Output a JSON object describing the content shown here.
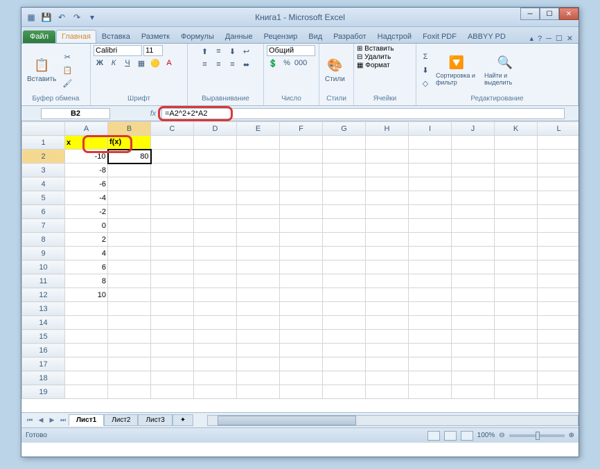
{
  "title": "Книга1 - Microsoft Excel",
  "qat": {
    "save": "💾",
    "undo": "↶",
    "redo": "↷"
  },
  "winbtns": {
    "min": "─",
    "max": "☐",
    "close": "✕"
  },
  "tabs": {
    "file": "Файл",
    "items": [
      "Главная",
      "Вставка",
      "Разметк",
      "Формулы",
      "Данные",
      "Рецензир",
      "Вид",
      "Разработ",
      "Надстрой",
      "Foxit PDF",
      "ABBYY PD"
    ],
    "active_index": 0
  },
  "ribbon": {
    "clipboard": {
      "paste": "Вставить",
      "label": "Буфер обмена",
      "cut": "✂",
      "copy": "📋",
      "brush": "🖌"
    },
    "font": {
      "name": "Calibri",
      "size": "11",
      "label": "Шрифт",
      "bold": "Ж",
      "italic": "К",
      "underline": "Ч"
    },
    "align": {
      "label": "Выравнивание"
    },
    "number": {
      "format": "Общий",
      "label": "Число"
    },
    "styles": {
      "label": "Стили",
      "btn": "Стили"
    },
    "cells": {
      "insert": "Вставить",
      "delete": "Удалить",
      "format": "Формат",
      "label": "Ячейки"
    },
    "editing": {
      "sort": "Сортировка и фильтр",
      "find": "Найти и выделить",
      "label": "Редактирование"
    }
  },
  "namebox": "B2",
  "fx": "fx",
  "formula": "=A2^2+2*A2",
  "columns": [
    "A",
    "B",
    "C",
    "D",
    "E",
    "F",
    "G",
    "H",
    "I",
    "J",
    "K",
    "L"
  ],
  "headers": {
    "a": "x",
    "b": "f(x)"
  },
  "rows": [
    {
      "n": 1
    },
    {
      "n": 2,
      "a": "-10",
      "b": "80"
    },
    {
      "n": 3,
      "a": "-8"
    },
    {
      "n": 4,
      "a": "-6"
    },
    {
      "n": 5,
      "a": "-4"
    },
    {
      "n": 6,
      "a": "-2"
    },
    {
      "n": 7,
      "a": "0"
    },
    {
      "n": 8,
      "a": "2"
    },
    {
      "n": 9,
      "a": "4"
    },
    {
      "n": 10,
      "a": "6"
    },
    {
      "n": 11,
      "a": "8"
    },
    {
      "n": 12,
      "a": "10"
    },
    {
      "n": 13
    },
    {
      "n": 14
    },
    {
      "n": 15
    },
    {
      "n": 16
    },
    {
      "n": 17
    },
    {
      "n": 18
    },
    {
      "n": 19
    }
  ],
  "sheets": [
    "Лист1",
    "Лист2",
    "Лист3"
  ],
  "active_sheet": 0,
  "status": "Готово",
  "zoom": "100%",
  "help": {
    "q": "?",
    "min": "▴",
    "restore": "☐",
    "close": "✕"
  }
}
